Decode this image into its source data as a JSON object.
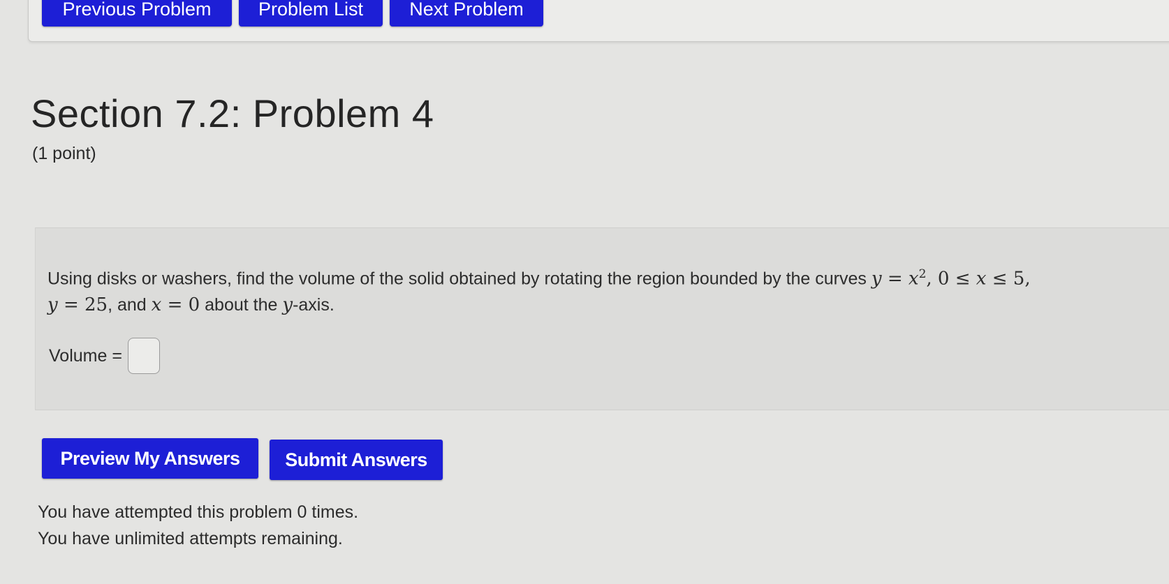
{
  "nav": {
    "previous_label": "Previous Problem",
    "list_label": "Problem List",
    "next_label": "Next Problem"
  },
  "problem": {
    "title": "Section 7.2: Problem 4",
    "points": "(1 point)",
    "text_part1": "Using disks or washers, find the volume of the solid obtained by rotating the region bounded by the curves ",
    "eq1_lhs": "y",
    "eq1_rel": " = ",
    "eq1_rhs": "x",
    "eq1_exp": "2",
    "sep1": ", ",
    "ineq_low": "0 ≤ ",
    "ineq_var": "x",
    "ineq_high": " ≤ 5",
    "sep2": ",",
    "eq2_lhs": "y",
    "eq2_rhs": " = 25",
    "text_part2": ", and ",
    "eq3_lhs": "x",
    "eq3_rhs": " = 0",
    "text_part3": " about the ",
    "axis_var": "y",
    "text_part4": "-axis."
  },
  "answer": {
    "label": "Volume =",
    "value": ""
  },
  "actions": {
    "preview_label": "Preview My Answers",
    "submit_label": "Submit Answers"
  },
  "status": {
    "attempted": "You have attempted this problem 0 times.",
    "remaining": "You have unlimited attempts remaining."
  }
}
